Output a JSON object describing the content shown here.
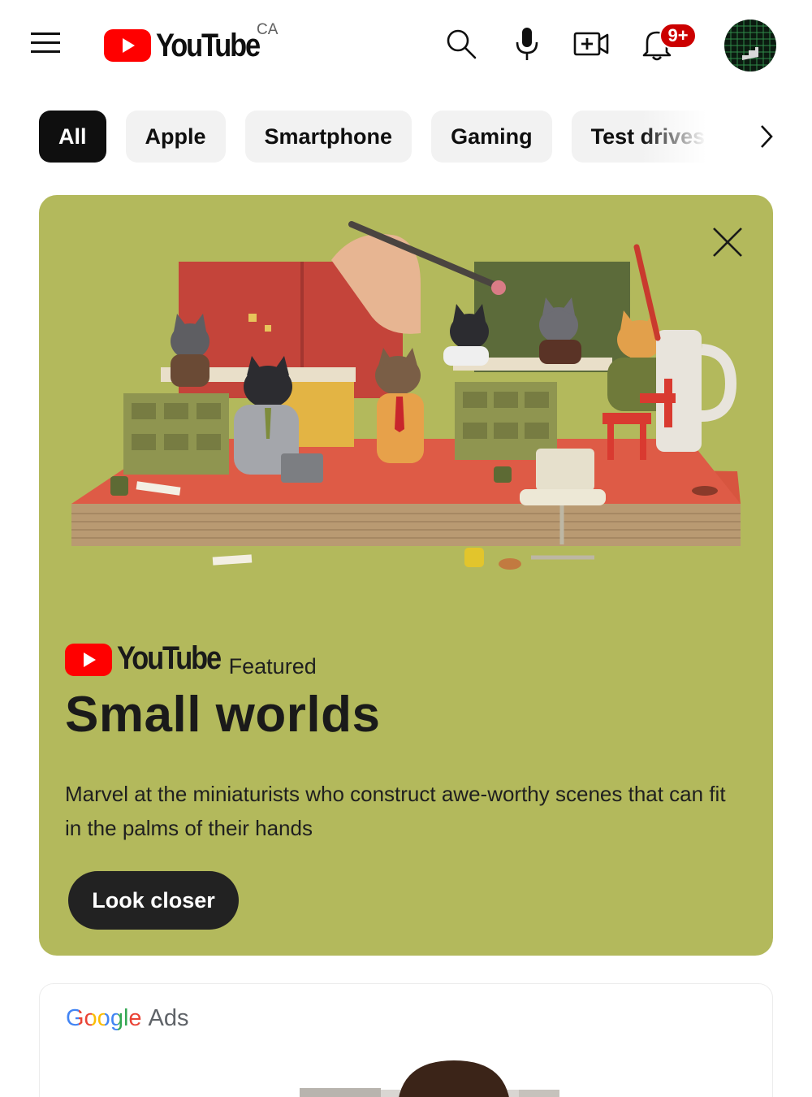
{
  "app": {
    "name": "YouTube",
    "country": "CA"
  },
  "header": {
    "notifications_badge": "9+",
    "icons": [
      "menu-icon",
      "search-icon",
      "microphone-icon",
      "create-video-icon",
      "bell-icon",
      "avatar"
    ]
  },
  "chips": [
    "All",
    "Apple",
    "Smartphone",
    "Gaming",
    "Test drives"
  ],
  "chips_active": "All",
  "featured": {
    "brand": "YouTube",
    "label": "Featured",
    "title": "Small worlds",
    "description": "Marvel at the miniaturists who construct awe-worthy scenes that can fit in the palms of their hands",
    "cta": "Look closer",
    "background": "#b3b95c"
  },
  "ad": {
    "brand_google": "Google",
    "brand_product": "Ads"
  },
  "colors": {
    "brand_red": "#ff0000",
    "chip_bg": "#f2f2f2",
    "chip_active": "#0f0f0f",
    "badge": "#cc0000"
  }
}
